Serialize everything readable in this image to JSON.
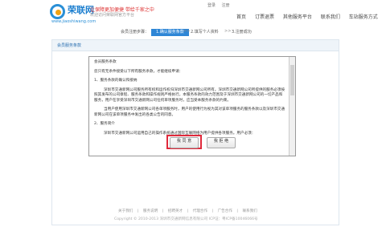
{
  "header": {
    "brand": "荣联网",
    "slogan": "让保障更加便捷 带给千家之中",
    "url": "www.jiaoshiwang.com",
    "sub": "欢迎访问荣联网官方平台",
    "toplinks": [
      "登录",
      "注册"
    ],
    "nav": [
      "首页",
      "订票退票",
      "其他服务平台",
      "联系我们",
      "车站服务方式"
    ]
  },
  "steps": {
    "label": "会员注册步骤：",
    "step1": "1.确认服务条款",
    "arrow": ">>",
    "step2": "2.填写个人资料",
    "step3": "3.注册成功"
  },
  "panel": {
    "title": "会员服务条款"
  },
  "terms": {
    "heading": "会员服务条款",
    "intro": "您只有无条件接受以下所有服务条款，才能继续申请：",
    "s1_title": "1、服务条款的确认和接纳",
    "s1_body": "深圳市交通新网公司服务所有权和运作权归深圳市交通新网公司所有。深圳市交通新网公司所提供的服务必须按照其发布的公司章程、服务条款和操作规则严格执行。本服务条款的效力范围及于深圳市交通新网公司的一切产品和服务，用户在享受深圳市交通新网公司任何单项服务时，应当受本服务条款的约束。",
    "s1_body2": "当用户使用深圳市交通新网公司各单项服务时，用户的使用行为视为其对该单项服务的服务条款以及深圳市交通新网公司在该单项服务中发出的各类公告的同意。",
    "s2_title": "2、服务简介",
    "s2_body": "深圳市交通新网公司运用自己的操作系统通过国际互联网络为用户提供各项服务。用户必须："
  },
  "buttons": {
    "agree": "我 同 意",
    "disagree": "我 拒 绝"
  },
  "footer": {
    "links": [
      "关于我们",
      "|",
      "服务说明",
      "|",
      "招聘英才",
      "|",
      "代理合作",
      "|",
      "广告合作",
      "|",
      "联系我们"
    ],
    "copyright": "Copyright © 2010-2013 深圳市交通新网信息有限公司 ICP证：粤ICP备10046066号"
  }
}
